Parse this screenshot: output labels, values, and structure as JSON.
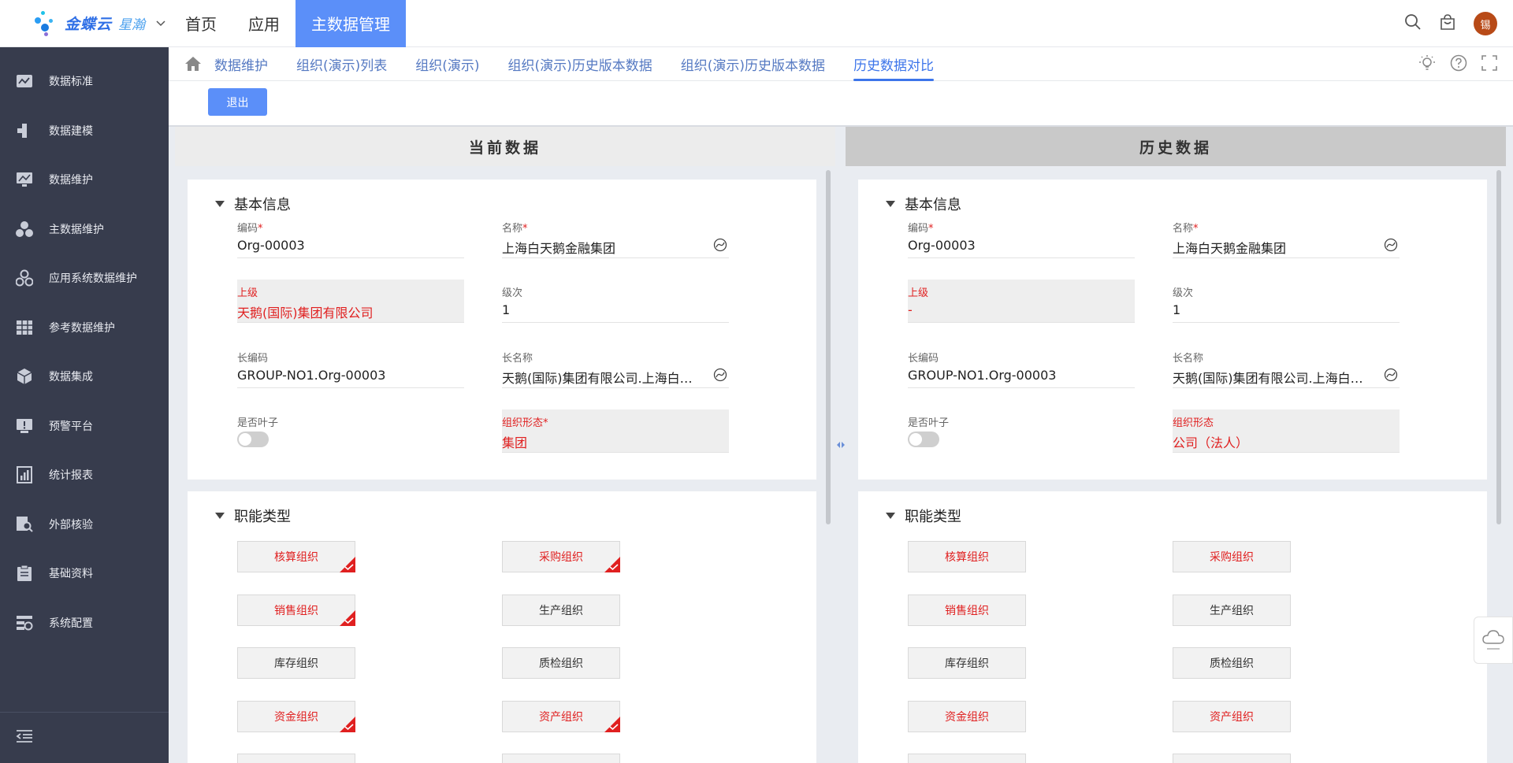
{
  "app": {
    "logo_text": "金蝶云",
    "logo_sub": "星瀚",
    "avatar_text": "锡"
  },
  "topnav": {
    "items": [
      {
        "label": "首页",
        "active": false
      },
      {
        "label": "应用",
        "active": false
      },
      {
        "label": "主数据管理",
        "active": true
      }
    ]
  },
  "sidebar": {
    "items": [
      {
        "label": "数据标准",
        "icon": "chart-icon"
      },
      {
        "label": "数据建模",
        "icon": "puzzle-icon"
      },
      {
        "label": "数据维护",
        "icon": "monitor-icon"
      },
      {
        "label": "主数据维护",
        "icon": "cluster-icon"
      },
      {
        "label": "应用系统数据维护",
        "icon": "apps-icon"
      },
      {
        "label": "参考数据维护",
        "icon": "table-icon"
      },
      {
        "label": "数据集成",
        "icon": "cube-icon"
      },
      {
        "label": "预警平台",
        "icon": "alert-screen-icon"
      },
      {
        "label": "统计报表",
        "icon": "report-icon"
      },
      {
        "label": "外部核验",
        "icon": "search-doc-icon"
      },
      {
        "label": "基础资料",
        "icon": "clipboard-icon"
      },
      {
        "label": "系统配置",
        "icon": "config-icon"
      }
    ]
  },
  "tabs": {
    "items": [
      {
        "label": "数据维护",
        "active": false
      },
      {
        "label": "组织(演示)列表",
        "active": false
      },
      {
        "label": "组织(演示)",
        "active": false
      },
      {
        "label": "组织(演示)历史版本数据",
        "active": false
      },
      {
        "label": "组织(演示)历史版本数据",
        "active": false
      },
      {
        "label": "历史数据对比",
        "active": true
      }
    ]
  },
  "toolbar": {
    "exit_label": "退出"
  },
  "left": {
    "header": "当前数据",
    "basic_title": "基本信息",
    "func_title": "职能类型",
    "fields": {
      "code": {
        "label": "编码",
        "value": "Org-00003"
      },
      "name": {
        "label": "名称",
        "value": "上海白天鹅金融集团"
      },
      "parent": {
        "label": "上级",
        "value": "天鹅(国际)集团有限公司"
      },
      "level": {
        "label": "级次",
        "value": "1"
      },
      "longcode": {
        "label": "长编码",
        "value": "GROUP-NO1.Org-00003"
      },
      "longname": {
        "label": "长名称",
        "value": "天鹅(国际)集团有限公司.上海白天鹅金融集团"
      },
      "isleaf": {
        "label": "是否叶子"
      },
      "form": {
        "label": "组织形态",
        "value": "集团"
      }
    },
    "chips": [
      {
        "label": "核算组织",
        "selected": true
      },
      {
        "label": "采购组织",
        "selected": true
      },
      {
        "label": "销售组织",
        "selected": true
      },
      {
        "label": "生产组织",
        "selected": false
      },
      {
        "label": "库存组织",
        "selected": false
      },
      {
        "label": "质检组织",
        "selected": false
      },
      {
        "label": "资金组织",
        "selected": true
      },
      {
        "label": "资产组织",
        "selected": true
      }
    ]
  },
  "right": {
    "header": "历史数据",
    "basic_title": "基本信息",
    "func_title": "职能类型",
    "fields": {
      "code": {
        "label": "编码",
        "value": "Org-00003"
      },
      "name": {
        "label": "名称",
        "value": "上海白天鹅金融集团"
      },
      "parent": {
        "label": "上级",
        "value": "-"
      },
      "level": {
        "label": "级次",
        "value": "1"
      },
      "longcode": {
        "label": "长编码",
        "value": "GROUP-NO1.Org-00003"
      },
      "longname": {
        "label": "长名称",
        "value": "天鹅(国际)集团有限公司.上海白天鹅金融集团"
      },
      "isleaf": {
        "label": "是否叶子"
      },
      "form": {
        "label": "组织形态",
        "value": "公司（法人）"
      }
    },
    "chips": [
      {
        "label": "核算组织"
      },
      {
        "label": "采购组织"
      },
      {
        "label": "销售组织"
      },
      {
        "label": "生产组织"
      },
      {
        "label": "库存组织"
      },
      {
        "label": "质检组织"
      },
      {
        "label": "资金组织"
      },
      {
        "label": "资产组织"
      }
    ]
  },
  "colors": {
    "accent": "#5b8ff9",
    "sidebar_bg": "#373c4d",
    "diff_red": "#e02020",
    "tab_text": "#5579c2"
  }
}
